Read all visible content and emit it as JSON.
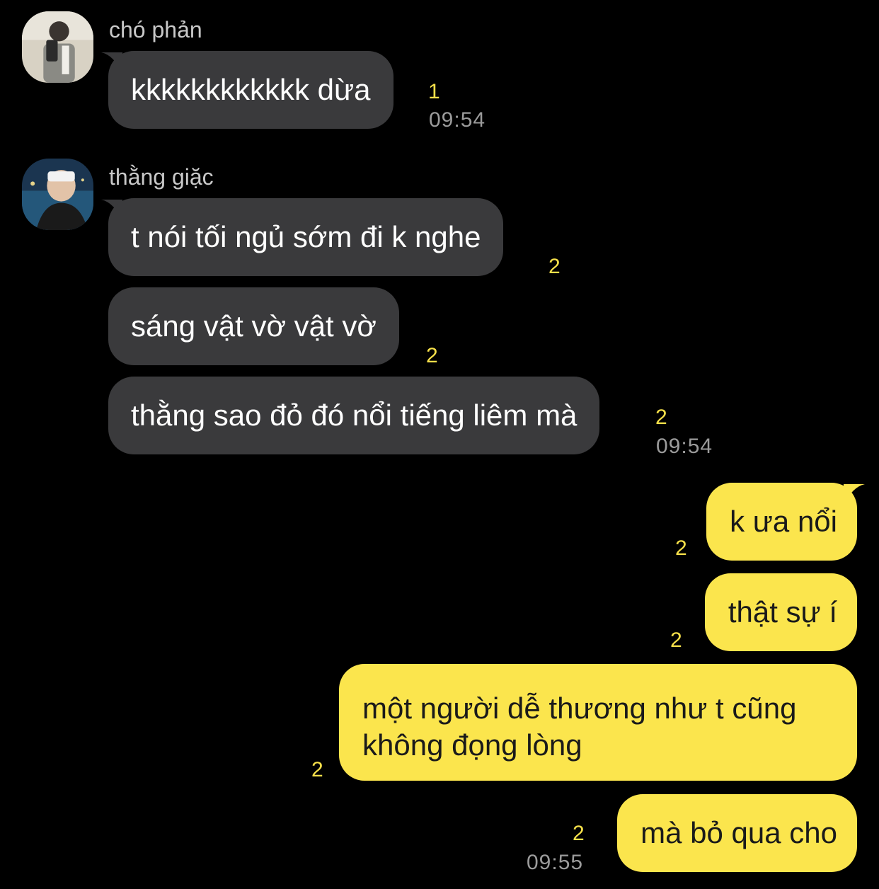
{
  "messages": {
    "group1": {
      "sender": "chó phản",
      "avatar": "avatar-photo-icon",
      "bubbles": [
        {
          "text": "kkkkkkkkkkkk dừa",
          "unread": "1"
        }
      ],
      "time": "09:54"
    },
    "group2": {
      "sender": "thằng giặc",
      "avatar": "avatar-photo-icon",
      "bubbles": [
        {
          "text": "t nói tối ngủ sớm đi k nghe",
          "unread": "2"
        },
        {
          "text": "sáng vật vờ vật vờ",
          "unread": "2"
        },
        {
          "text": "thằng sao đỏ đó nổi tiếng liêm mà",
          "unread": "2"
        }
      ],
      "time": "09:54"
    },
    "outgoing": {
      "bubbles": [
        {
          "text": "k ưa nổi",
          "unread": "2"
        },
        {
          "text": "thật sự í",
          "unread": "2"
        },
        {
          "text": "một người dễ thương như t cũng không đọng lòng",
          "unread": "2"
        },
        {
          "text": "mà bỏ qua cho",
          "unread": "2"
        }
      ],
      "time": "09:55"
    }
  },
  "colors": {
    "background": "#000000",
    "incoming_bubble": "#3a3a3c",
    "outgoing_bubble": "#fbe54d",
    "unread_count": "#f6e04a",
    "timestamp": "#9b9b9b"
  }
}
